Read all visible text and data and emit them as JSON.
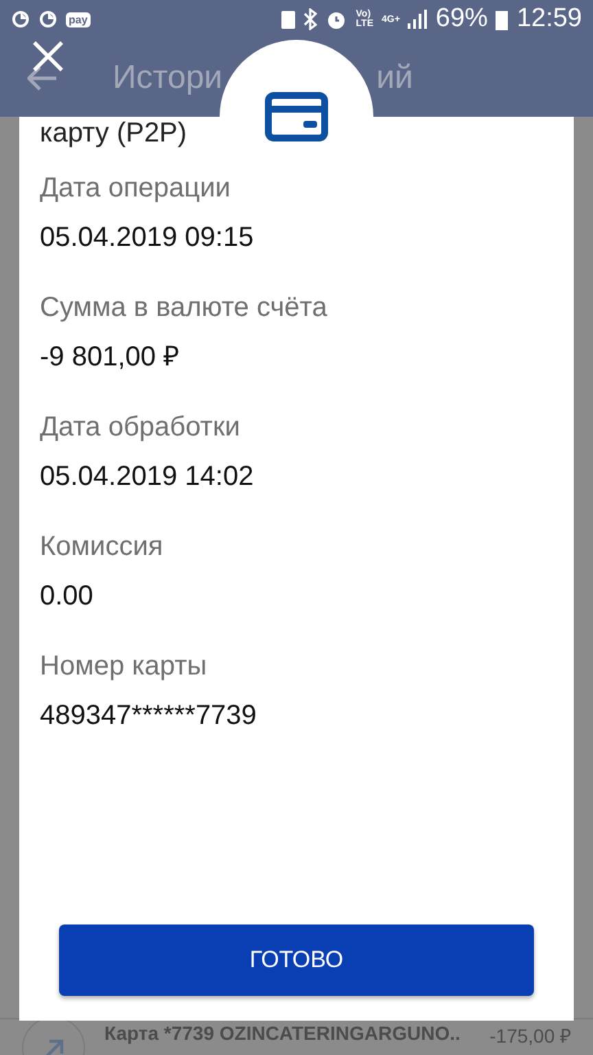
{
  "status_bar": {
    "pay_badge": "pay",
    "volte": [
      "Vo)",
      "LTE"
    ],
    "network": "4G+",
    "battery": "69%",
    "time": "12:59"
  },
  "header": {
    "title_parts": [
      "Истори",
      "ий"
    ]
  },
  "background_row": {
    "title": "Карта *7739 OZINCATERINGARGUNO..",
    "amount": "-175,00 ₽"
  },
  "dialog": {
    "cut_text": "карту (P2P)",
    "fields": [
      {
        "label": "Дата операции",
        "value": "05.04.2019 09:15"
      },
      {
        "label": "Сумма в валюте счёта",
        "value": "-9 801,00 ₽"
      },
      {
        "label": "Дата обработки",
        "value": "05.04.2019 14:02"
      },
      {
        "label": "Комиссия",
        "value": "0.00"
      },
      {
        "label": "Номер карты",
        "value": "489347******7739"
      }
    ],
    "button": "ГОТОВО"
  }
}
